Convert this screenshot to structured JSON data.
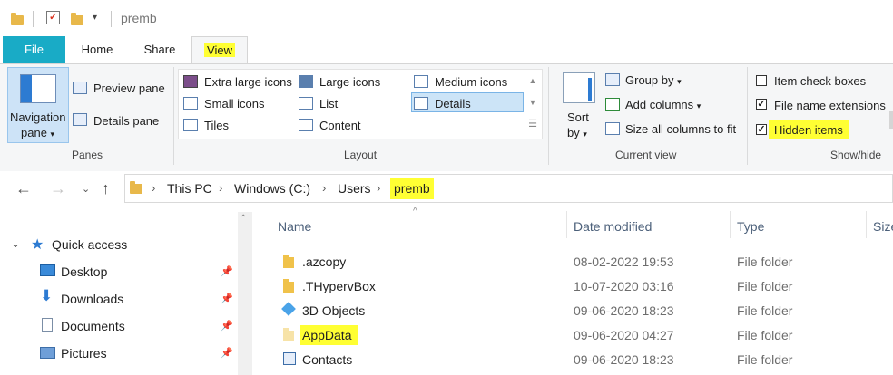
{
  "window": {
    "title": "premb"
  },
  "tabs": {
    "file": "File",
    "home": "Home",
    "share": "Share",
    "view": "View"
  },
  "ribbon": {
    "panes": {
      "navigation_pane_line1": "Navigation",
      "navigation_pane_line2": "pane",
      "preview_pane": "Preview pane",
      "details_pane": "Details pane",
      "group_label": "Panes"
    },
    "layout": {
      "extra_large_icons": "Extra large icons",
      "large_icons": "Large icons",
      "medium_icons": "Medium icons",
      "small_icons": "Small icons",
      "list": "List",
      "details": "Details",
      "tiles": "Tiles",
      "content": "Content",
      "group_label": "Layout",
      "selected": "Details"
    },
    "current_view": {
      "sort_line1": "Sort",
      "sort_line2": "by",
      "group_by": "Group by",
      "add_columns": "Add columns",
      "size_all_columns": "Size all columns to fit",
      "group_label": "Current view"
    },
    "show_hide": {
      "item_check_boxes": {
        "label": "Item check boxes",
        "checked": false
      },
      "file_name_extensions": {
        "label": "File name extensions",
        "checked": true
      },
      "hidden_items": {
        "label": "Hidden items",
        "checked": true
      },
      "group_label": "Show/hide"
    }
  },
  "address": {
    "crumbs": [
      "This PC",
      "Windows (C:)",
      "Users",
      "premb"
    ]
  },
  "nav": {
    "items": [
      {
        "label": "Quick access",
        "icon": "star-icon"
      },
      {
        "label": "Desktop",
        "icon": "desktop-icon",
        "pinned": true
      },
      {
        "label": "Downloads",
        "icon": "download-icon",
        "pinned": true
      },
      {
        "label": "Documents",
        "icon": "document-icon",
        "pinned": true
      },
      {
        "label": "Pictures",
        "icon": "picture-icon",
        "pinned": true
      }
    ]
  },
  "columns": {
    "name": "Name",
    "date_modified": "Date modified",
    "type": "Type",
    "size": "Size"
  },
  "files": [
    {
      "name": ".azcopy",
      "date": "08-02-2022 19:53",
      "type": "File folder"
    },
    {
      "name": ".THypervBox",
      "date": "10-07-2020 03:16",
      "type": "File folder"
    },
    {
      "name": "3D Objects",
      "date": "09-06-2020 18:23",
      "type": "File folder"
    },
    {
      "name": "AppData",
      "date": "09-06-2020 04:27",
      "type": "File folder"
    },
    {
      "name": "Contacts",
      "date": "09-06-2020 18:23",
      "type": "File folder"
    }
  ],
  "colors": {
    "file_tab": "#19abc6",
    "highlight": "#ffff33",
    "selection": "#cce4f7"
  }
}
